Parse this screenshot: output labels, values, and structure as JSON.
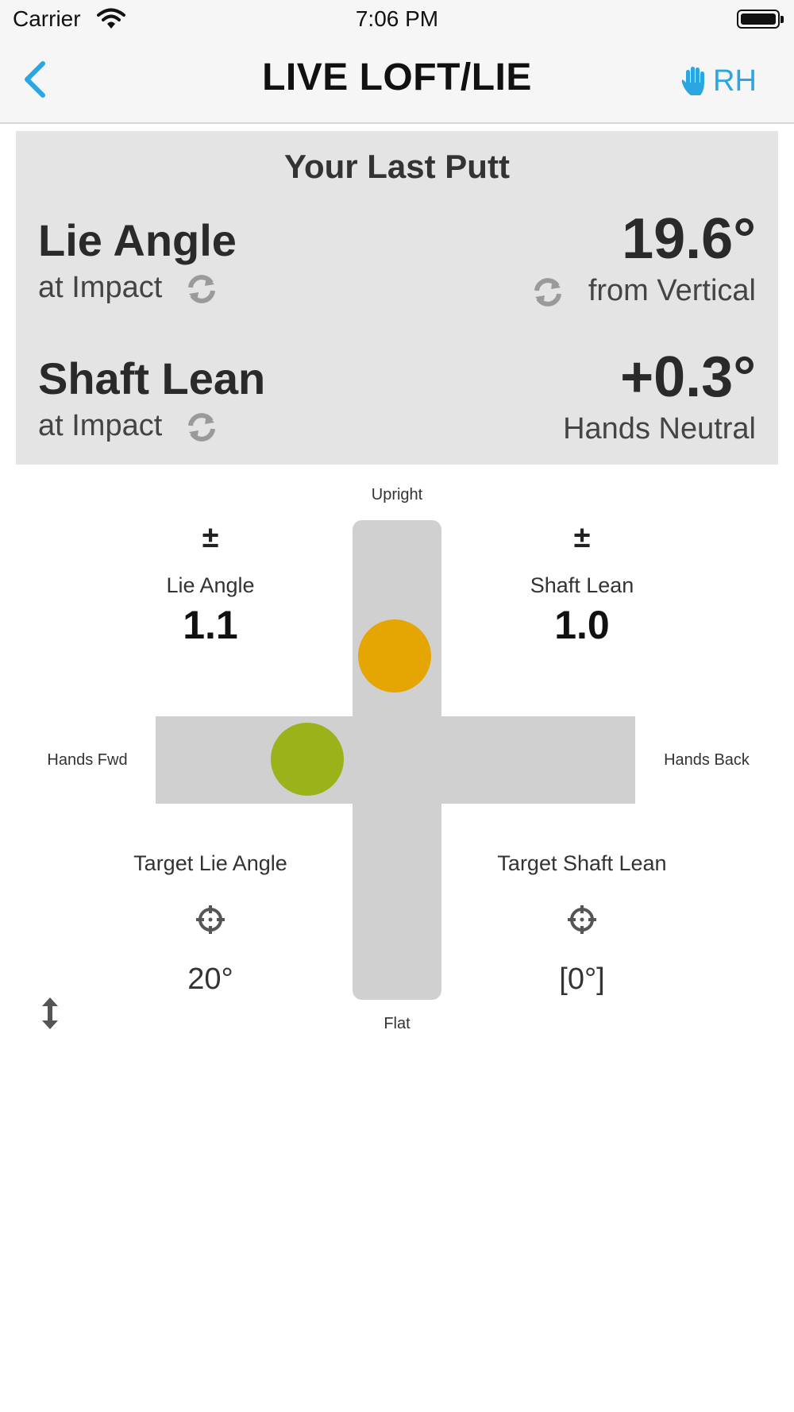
{
  "status_bar": {
    "carrier": "Carrier",
    "time": "7:06 PM"
  },
  "nav": {
    "title": "LIVE LOFT/LIE",
    "hand_label": "RH",
    "accent_color": "#2ba6e0"
  },
  "last_putt": {
    "title": "Your Last Putt",
    "lie": {
      "label": "Lie Angle",
      "sub": "at Impact",
      "value": "19.6°",
      "desc": "from Vertical"
    },
    "lean": {
      "label": "Shaft Lean",
      "sub": "at Impact",
      "value": "+0.3°",
      "desc": "Hands Neutral"
    }
  },
  "visualizer": {
    "top_label": "Upright",
    "bottom_label": "Flat",
    "left_label": "Hands Fwd",
    "right_label": "Hands Back",
    "lie": {
      "tolerance_symbol": "±",
      "label": "Lie Angle",
      "tolerance": "1.1",
      "target_label": "Target Lie Angle",
      "target_value": "20°",
      "indicator_color": "#e5a604"
    },
    "lean": {
      "tolerance_symbol": "±",
      "label": "Shaft Lean",
      "tolerance": "1.0",
      "target_label": "Target Shaft Lean",
      "target_value": "[0°]",
      "indicator_color": "#9bb21a"
    }
  }
}
